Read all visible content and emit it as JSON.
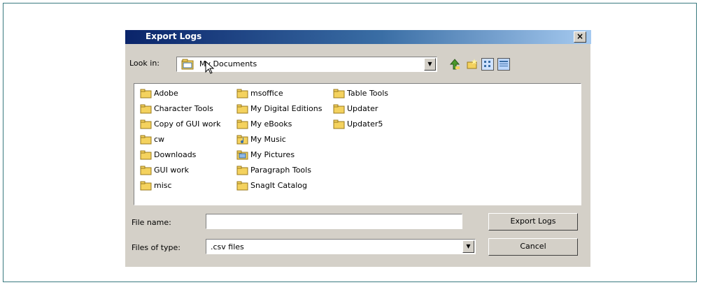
{
  "dialog": {
    "title": "Export Logs",
    "close_label": "×"
  },
  "lookin": {
    "label": "Look in:",
    "value": "My Documents",
    "arrow": "▼"
  },
  "files": {
    "col1": [
      "Adobe",
      "Character Tools",
      "Copy of GUI work",
      "cw",
      "Downloads",
      "GUI work",
      "misc"
    ],
    "col2": [
      "msoffice",
      "My Digital Editions",
      "My eBooks",
      "My Music",
      "My Pictures",
      "Paragraph Tools",
      "SnagIt Catalog"
    ],
    "col3": [
      "Table Tools",
      "Updater",
      "Updater5"
    ]
  },
  "filename": {
    "label": "File name:",
    "value": ""
  },
  "filetype": {
    "label": "Files of type:",
    "value": ".csv files",
    "arrow": "▼"
  },
  "buttons": {
    "export": "Export Logs",
    "cancel": "Cancel"
  },
  "colors": {
    "folder": "#f4d25e",
    "title_start": "#0a246a",
    "title_end": "#a6caf0"
  }
}
